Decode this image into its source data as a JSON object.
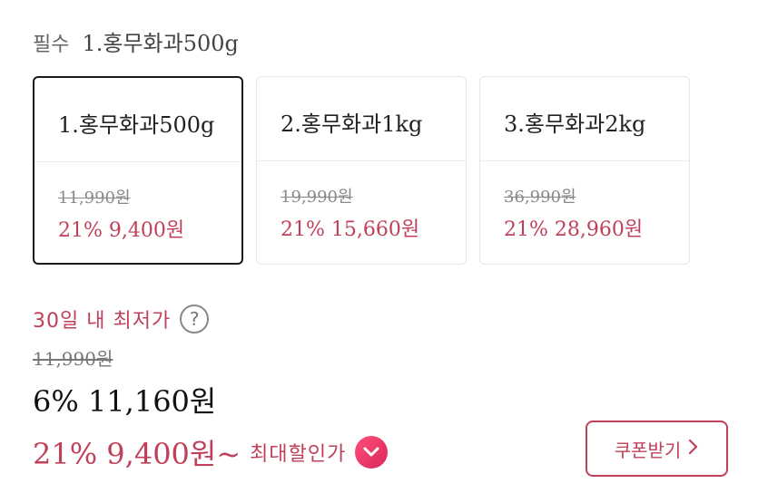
{
  "header": {
    "required": "필수",
    "selected_option": "1.홍무화과500g"
  },
  "options": [
    {
      "name": "1.홍무화과500g",
      "original_price": "11,990원",
      "discount": "21% 9,400원",
      "selected": true
    },
    {
      "name": "2.홍무화과1kg",
      "original_price": "19,990원",
      "discount": "21% 15,660원",
      "selected": false
    },
    {
      "name": "3.홍무화과2kg",
      "original_price": "36,990원",
      "discount": "21% 28,960원",
      "selected": false
    }
  ],
  "lowest": {
    "label": "30일 내 최저가",
    "help_icon": "question-icon",
    "help_glyph": "?"
  },
  "price": {
    "original": "11,990원",
    "current": "6% 11,160원",
    "max_discount": "21% 9,400원~",
    "max_label": "최대할인가"
  },
  "coupon": {
    "label": "쿠폰받기"
  },
  "colors": {
    "accent": "#c0405a",
    "selected_border": "#1a1a1a",
    "chevron_bg": "#e8345f"
  }
}
